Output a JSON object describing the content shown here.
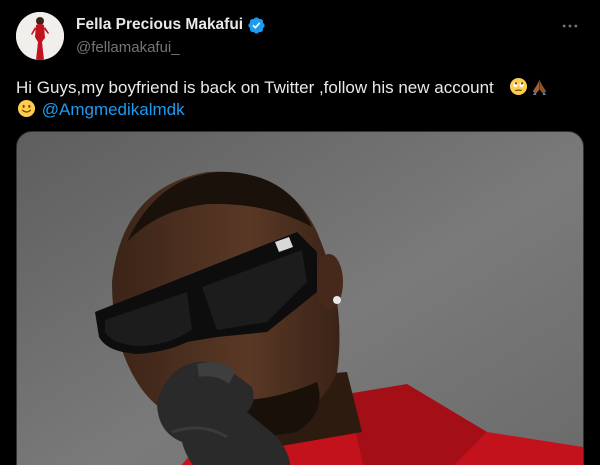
{
  "author": {
    "display_name": "Fella Precious Makafui",
    "handle": "@fellamakafui_",
    "verified": true,
    "verified_color": "#1d9bf0"
  },
  "tweet": {
    "text_before_emojis": "Hi Guys,my boyfriend is back on Twitter ,follow his new account",
    "emojis_line1": [
      "face-with-rolling-eyes-emoji",
      "folded-hands-emoji"
    ],
    "emoji_line2": "slightly-smiling-face-emoji",
    "mention": "@Amgmedikalmdk",
    "mention_color": "#1d9bf0"
  },
  "menu": {
    "icon": "more-horizontal-icon",
    "symbol": "···"
  },
  "media": {
    "subject": "photo-man-sunglasses-red-jacket"
  }
}
